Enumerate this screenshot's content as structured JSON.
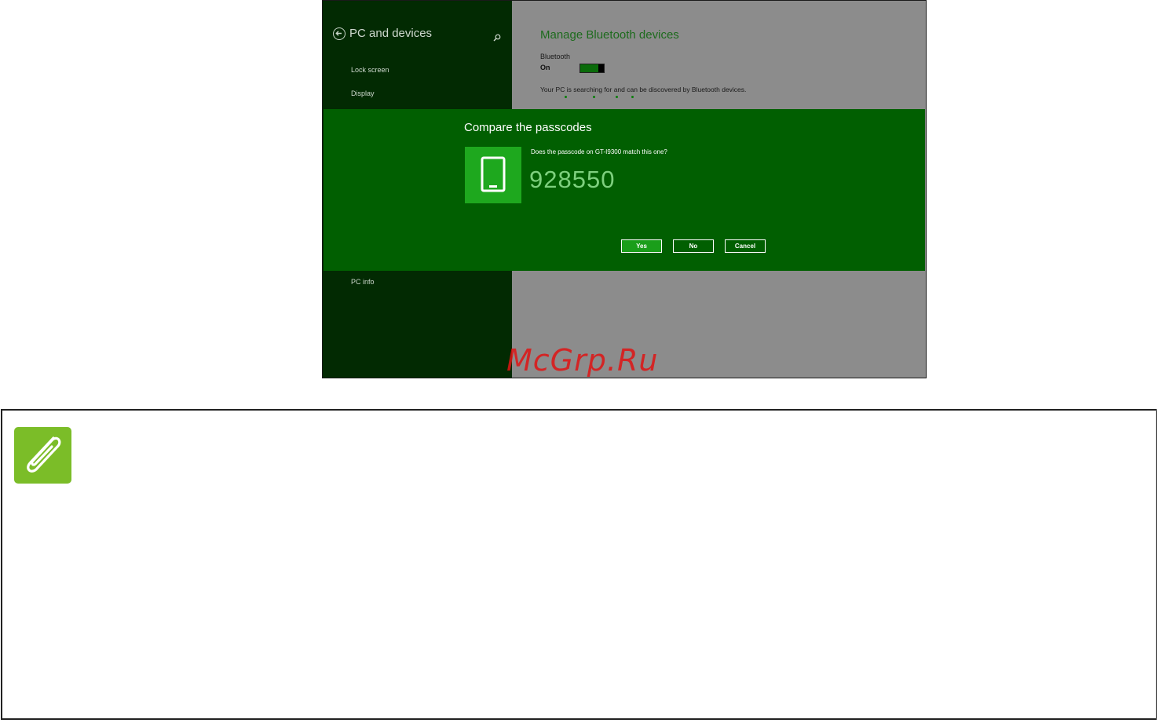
{
  "sidebar": {
    "title": "PC and devices",
    "items": [
      "Lock screen",
      "Display"
    ],
    "bottom_item": "PC info"
  },
  "main": {
    "title": "Manage Bluetooth devices",
    "bluetooth_label": "Bluetooth",
    "bluetooth_state": "On",
    "status": "Your PC is searching for and can be discovered by Bluetooth devices."
  },
  "dialog": {
    "title": "Compare the passcodes",
    "question": "Does the passcode on GT-I9300 match this one?",
    "passcode": "928550",
    "buttons": {
      "yes": "Yes",
      "no": "No",
      "cancel": "Cancel"
    }
  },
  "watermark": "McGrp.Ru",
  "icons": {
    "back": "back-arrow-icon",
    "search": "search-icon",
    "phone": "phone-icon",
    "note": "paperclip-icon"
  },
  "colors": {
    "sidebar_bg": "#022a02",
    "dialog_bg": "#015f01",
    "accent": "#1ea81e",
    "note_icon": "#7bbd28"
  }
}
